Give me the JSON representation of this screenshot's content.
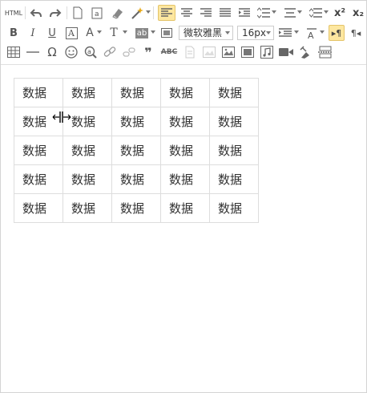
{
  "toolbar": {
    "row1": {
      "html_label": "HTML",
      "superscript": "x²",
      "subscript": "x₂"
    },
    "row2": {
      "bold": "B",
      "italic": "I",
      "underline": "U",
      "font_box": "A",
      "font_color": "A",
      "font_size_tool": "T",
      "background_label": "ab",
      "font_family": "微软雅黑",
      "font_size": "16px",
      "ltr": "▸¶",
      "rtl": "¶◂"
    },
    "row3": {
      "omega": "Ω",
      "quote": "❞",
      "abc": "ABC"
    }
  },
  "table": {
    "rows": [
      [
        "数据",
        "数据",
        "数据",
        "数据",
        "数据"
      ],
      [
        "数据",
        "数据",
        "数据",
        "数据",
        "数据"
      ],
      [
        "数据",
        "数据",
        "数据",
        "数据",
        "数据"
      ],
      [
        "数据",
        "数据",
        "数据",
        "数据",
        "数据"
      ],
      [
        "数据",
        "数据",
        "数据",
        "数据",
        "数据"
      ]
    ]
  },
  "colors": {
    "active_bg": "#fde7a0",
    "border": "#d4d4d4"
  }
}
